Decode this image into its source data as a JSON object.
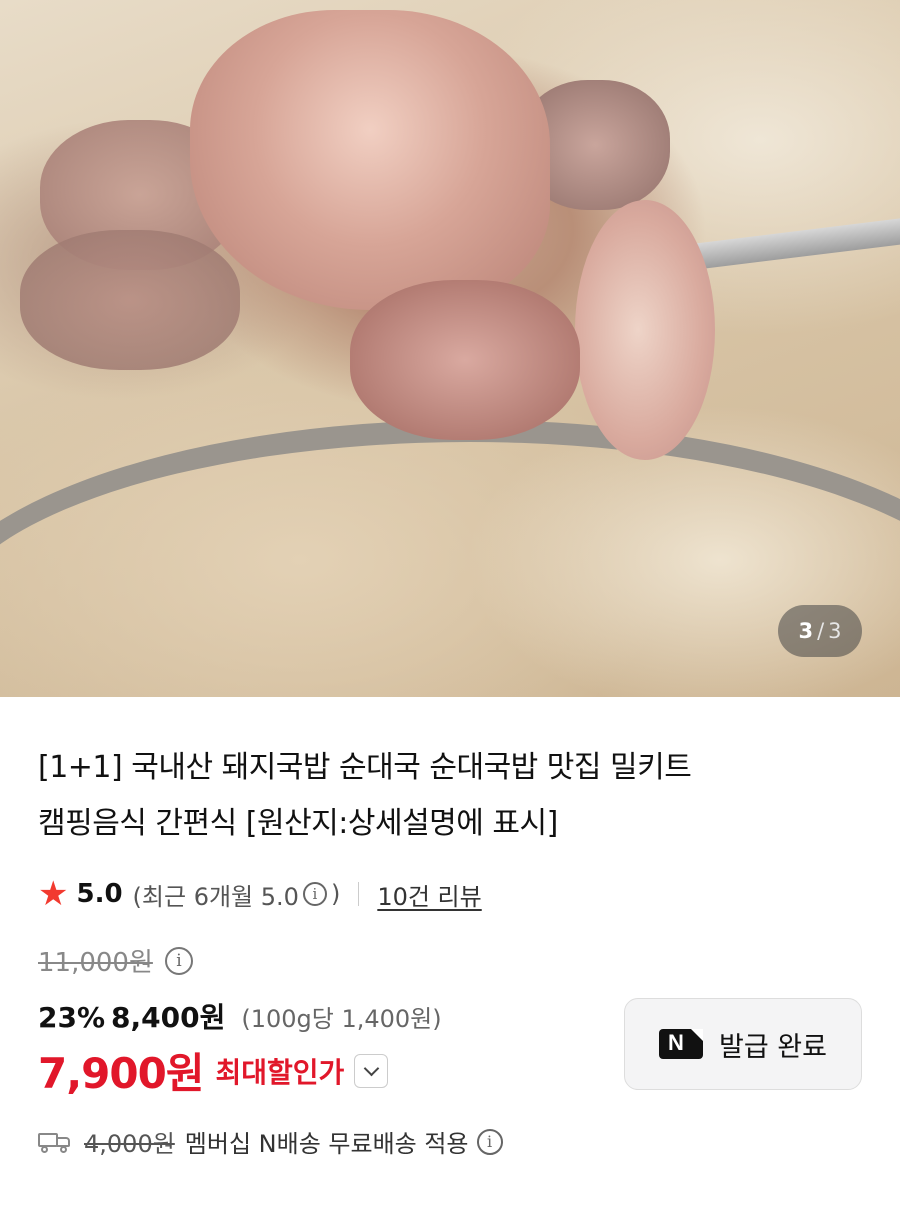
{
  "gallery": {
    "current": "3",
    "separator": "/",
    "total": "3"
  },
  "product": {
    "title_line1": "[1+1] 국내산 돼지국밥 순대국 순대국밥 맛집 밀키트",
    "title_line2": "캠핑음식 간편식 [원산지:상세설명에 표시]"
  },
  "rating": {
    "score": "5.0",
    "recent_open": "(최근 6개월 5.0",
    "recent_close": ")",
    "reviews_link": "10건 리뷰"
  },
  "price": {
    "original": "11,000원",
    "discount_percent": "23%",
    "sale_price": "8,400원",
    "unit_price": "(100g당 1,400원)",
    "max_discount_price": "7,900원",
    "max_discount_label": "최대할인가"
  },
  "coupon": {
    "label": "발급 완료"
  },
  "delivery": {
    "original_fee": "4,000원",
    "text": "멤버십 N배송 무료배송 적용"
  },
  "colors": {
    "accent_red": "#e1172a",
    "star": "#f23a2f"
  },
  "icons": {
    "rating": "star-icon",
    "info": "info-icon",
    "coupon": "naver-n-icon",
    "delivery": "truck-icon",
    "expand": "chevron-down-icon"
  }
}
